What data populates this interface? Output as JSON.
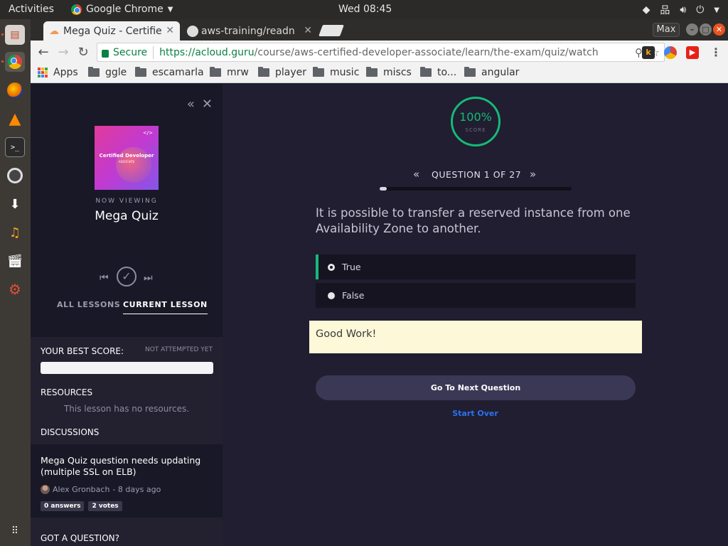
{
  "os": {
    "activities": "Activities",
    "app_name": "Google Chrome",
    "clock": "Wed 08:45"
  },
  "browser": {
    "tabs": [
      {
        "title": "Mega Quiz - Certifie",
        "active": true
      },
      {
        "title": "aws-training/readn",
        "active": false
      }
    ],
    "max_label": "Max",
    "secure_label": "Secure",
    "url_scheme_host": "https://acloud.guru",
    "url_path": "/course/aws-certified-developer-associate/learn/the-exam/quiz/watch",
    "bookmarks": [
      "Apps",
      "ggle",
      "escamarla",
      "mrw",
      "player",
      "music",
      "miscs",
      "to...",
      "angular"
    ]
  },
  "sidebar": {
    "course_image": {
      "title": "Certified Developer",
      "subtitle": "ASSOCIATE",
      "code_glyph": "</>"
    },
    "now_viewing": "NOW VIEWING",
    "lesson_title": "Mega Quiz",
    "tabs": {
      "all": "ALL LESSONS",
      "current": "CURRENT LESSON"
    },
    "best_score_label": "YOUR BEST SCORE:",
    "best_score_status": "NOT ATTEMPTED YET",
    "resources_label": "RESOURCES",
    "no_resources": "This lesson has no resources.",
    "discussions_label": "DISCUSSIONS",
    "discussion": {
      "title": "Mega Quiz question needs updating (multiple SSL on ELB)",
      "author": "Alex Gronbach",
      "age": "- 8 days ago",
      "answers": "0 answers",
      "votes": "2 votes"
    },
    "got_question": "GOT A QUESTION?"
  },
  "quiz": {
    "score": "100%",
    "score_label": "SCORE",
    "question_label": "QUESTION 1 OF 27",
    "progress_fraction": 0.037,
    "question": "It is possible to transfer a reserved instance from one Availability Zone to another.",
    "options": [
      {
        "label": "True",
        "selected": true
      },
      {
        "label": "False",
        "selected": false
      }
    ],
    "feedback": "Good Work!",
    "next_button": "Go To Next Question",
    "start_over": "Start Over"
  },
  "colors": {
    "accent_green": "#16b979",
    "link_blue": "#2a71f0",
    "feedback_bg": "#fdf8d8",
    "page_bg": "#201e30"
  }
}
